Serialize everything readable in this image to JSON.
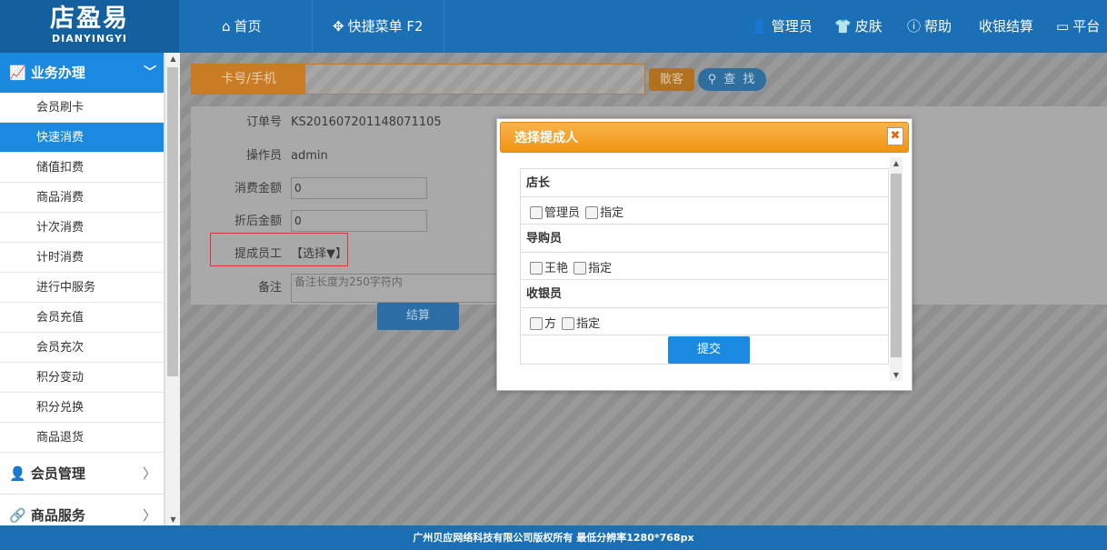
{
  "brand": {
    "name": "店盈易",
    "sub": "DIANYINGYI"
  },
  "nav": {
    "home": "首页",
    "quick_menu": "快捷菜单 F2",
    "admin": "管理员",
    "skin": "皮肤",
    "help": "帮助",
    "checkout": "收银结算",
    "platform": "平台"
  },
  "sidebar": {
    "section": "业务办理",
    "items": [
      "会员刷卡",
      "快速消费",
      "储值扣费",
      "商品消费",
      "计次消费",
      "计时消费",
      "进行中服务",
      "会员充值",
      "会员充次",
      "积分变动",
      "积分兑换",
      "商品退货"
    ],
    "active_index": 1,
    "groups": [
      "会员管理",
      "商品服务"
    ]
  },
  "search": {
    "card_label": "卡号/手机",
    "guest_btn": "散客",
    "search_btn": "查 找"
  },
  "form": {
    "order_label": "订单号",
    "order_value": "KS201607201148071105",
    "operator_label": "操作员",
    "operator_value": "admin",
    "amount_label": "消费金额",
    "amount_value": "0",
    "discount_label": "折后金额",
    "discount_value": "0",
    "staff_label": "提成员工",
    "staff_select": "【选择▼】",
    "note_label": "备注",
    "note_placeholder": "备注长度为250字符内",
    "settle_btn": "结算"
  },
  "dialog": {
    "title": "选择提成人",
    "close": "✖",
    "roles": [
      {
        "name": "店长",
        "options": [
          "管理员",
          "指定"
        ]
      },
      {
        "name": "导购员",
        "options": [
          "王艳",
          "指定"
        ]
      },
      {
        "name": "收银员",
        "options": [
          "方",
          "指定"
        ]
      }
    ],
    "submit": "提交"
  },
  "footer": "广州贝应网络科技有限公司版权所有 最低分辨率1280*768px"
}
